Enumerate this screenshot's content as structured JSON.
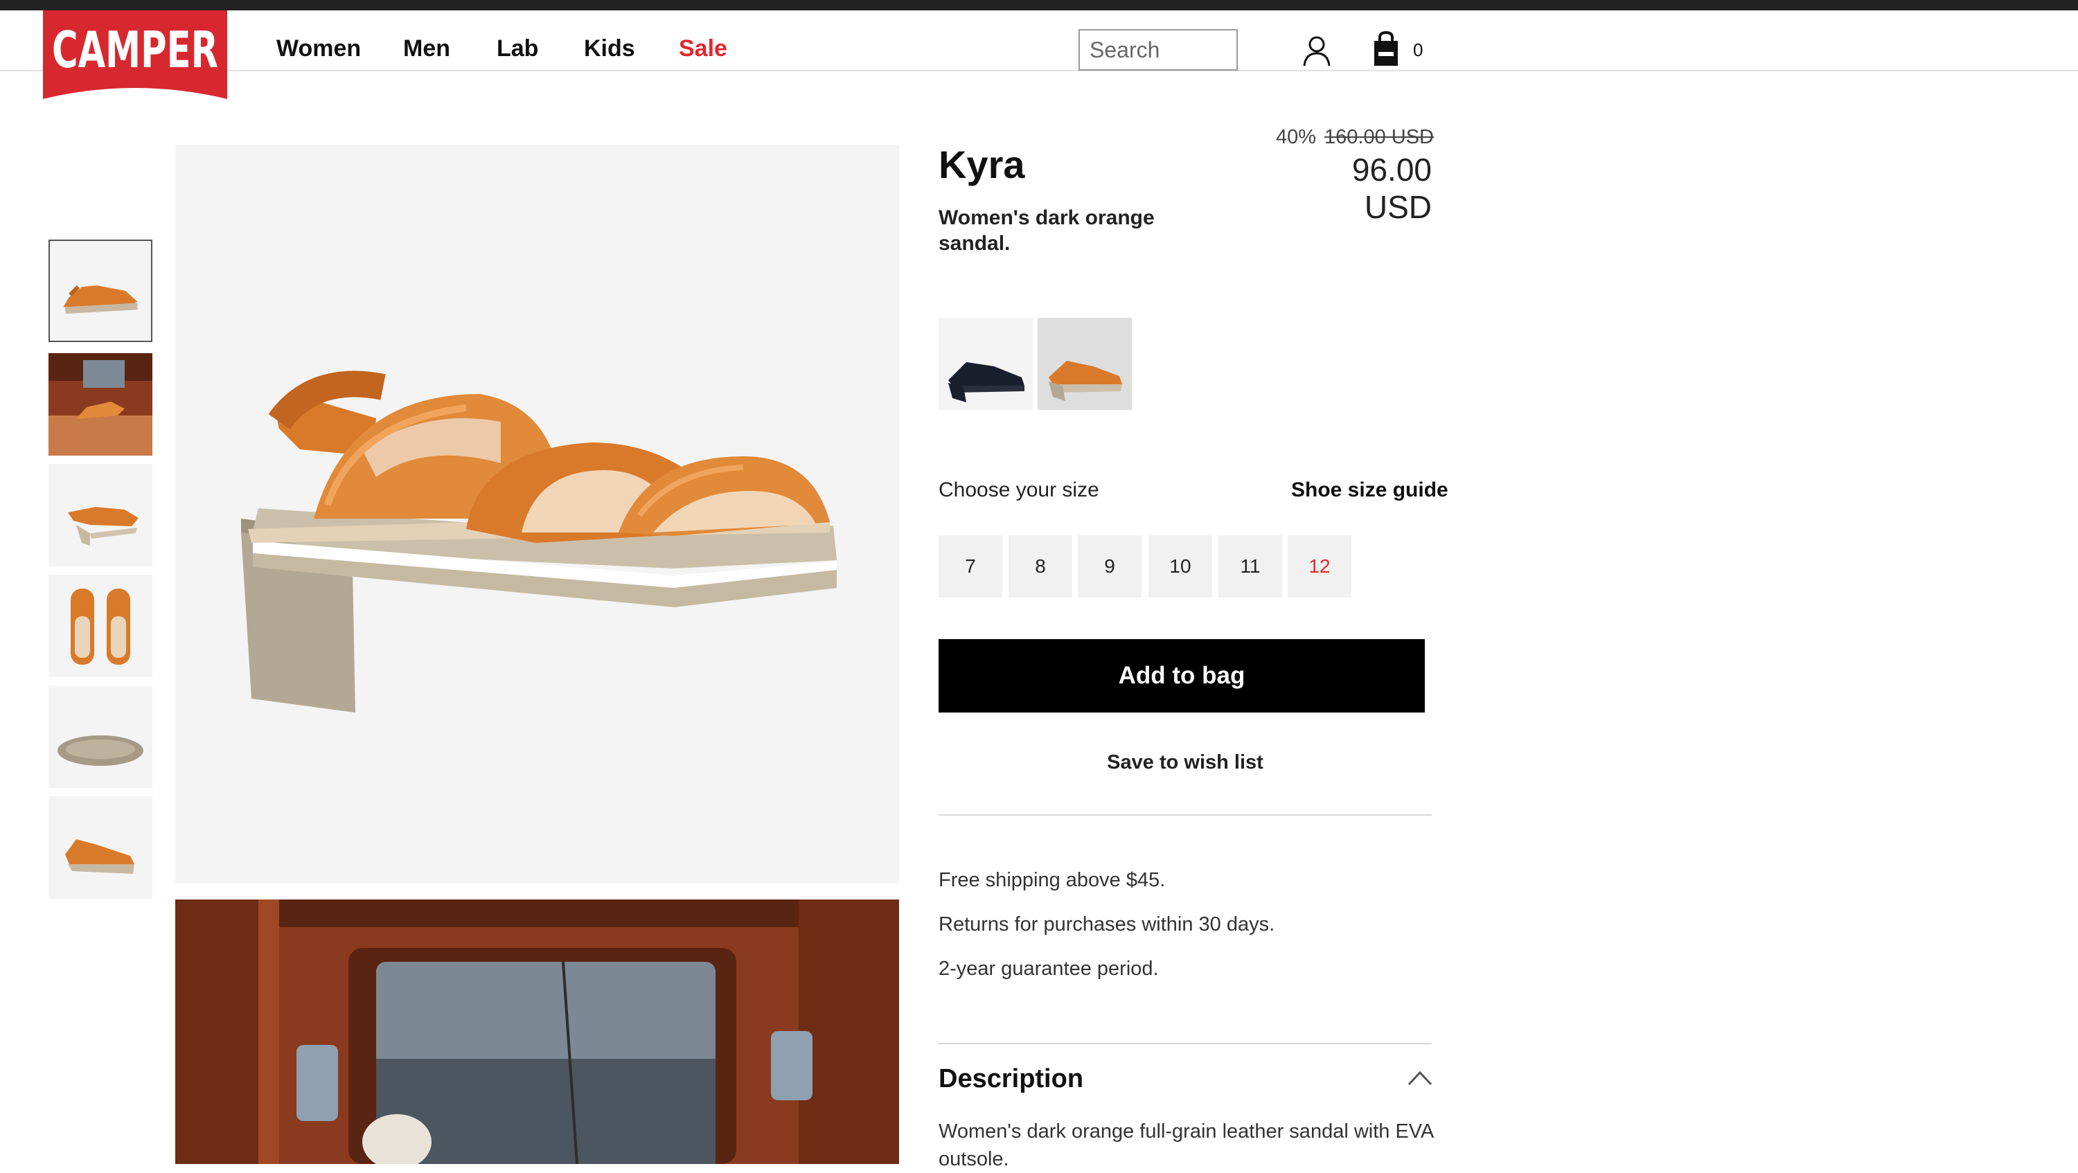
{
  "brand": {
    "logo_text": "CAMPER"
  },
  "nav": {
    "items": [
      {
        "label": "Women"
      },
      {
        "label": "Men"
      },
      {
        "label": "Lab"
      },
      {
        "label": "Kids"
      },
      {
        "label": "Sale"
      }
    ]
  },
  "header": {
    "search_placeholder": "Search",
    "bag_count": "0",
    "user_icon": "user-icon",
    "bag_icon": "shopping-bag-icon"
  },
  "gallery": {
    "thumbnail_count": 6,
    "selected_index": 0
  },
  "product": {
    "name": "Kyra",
    "description_short": "Women's dark orange sandal.",
    "discount": "40%",
    "original_price": "160.00 USD",
    "price": "96.00 USD"
  },
  "colors": {
    "options": [
      "black",
      "dark orange"
    ],
    "selected": "dark orange"
  },
  "sizes": {
    "label": "Choose your size",
    "guide_label": "Shoe size guide",
    "options": [
      "7",
      "8",
      "9",
      "10",
      "11",
      "12"
    ]
  },
  "actions": {
    "add_to_bag": "Add to bag",
    "wishlist": "Save to wish list"
  },
  "info": [
    "Free shipping above $45.",
    "Returns for purchases within 30 days.",
    "2-year guarantee period."
  ],
  "description": {
    "title": "Description",
    "text": "Women's dark orange full-grain leather sandal with EVA outsole."
  },
  "theme": {
    "accent_red": "#e0282e",
    "logo_red": "#d7282f",
    "button_black": "#000000"
  }
}
